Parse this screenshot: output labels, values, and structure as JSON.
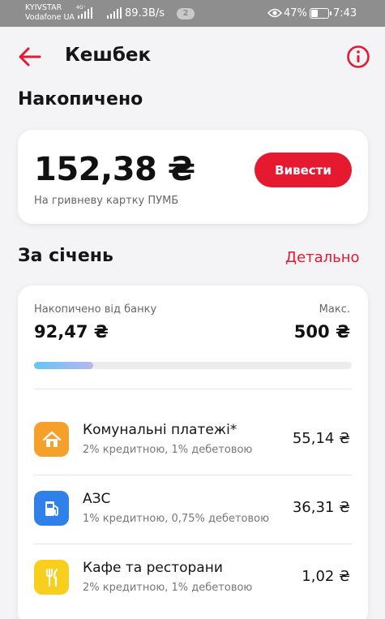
{
  "status_bar": {
    "carrier_1": "KYIVSTAR",
    "carrier_2": "Vodafone UA",
    "network_type": "4G⁺",
    "speed": "89.3B/s",
    "notification_count": "2",
    "battery": "47%",
    "battery_level": 0.47,
    "time": "7:43"
  },
  "header": {
    "title": "Кешбек",
    "back_icon": "arrow-left-icon",
    "info_icon": "info-circle-icon"
  },
  "accumulated": {
    "title": "Накопичено",
    "amount": "152,38 ₴",
    "subtitle": "На гривневу картку ПУМБ",
    "withdraw_label": "Вивести"
  },
  "month": {
    "title": "За січень",
    "details_label": "Детально",
    "bank_label": "Накопичено від банку",
    "bank_value": "92,47 ₴",
    "max_label": "Макс.",
    "max_value": "500 ₴",
    "progress": 0.185,
    "categories": [
      {
        "name": "Комунальні платежі*",
        "rate": "2% кредитною, 1% дебетовою",
        "amount": "55,14 ₴",
        "icon": "house-icon",
        "color": "#f5a02a"
      },
      {
        "name": "АЗС",
        "rate": "1% кредитною, 0,75% дебетовою",
        "amount": "36,31 ₴",
        "icon": "fuel-pump-icon",
        "color": "#2f80e8"
      },
      {
        "name": "Кафе та ресторани",
        "rate": "2% кредитною, 1% дебетовою",
        "amount": "1,02 ₴",
        "icon": "fork-knife-icon",
        "color": "#f9cf1e"
      }
    ]
  },
  "colors": {
    "accent": "#e5192f",
    "background": "#f4f4f6",
    "status_bar": "#8e8e8e"
  }
}
